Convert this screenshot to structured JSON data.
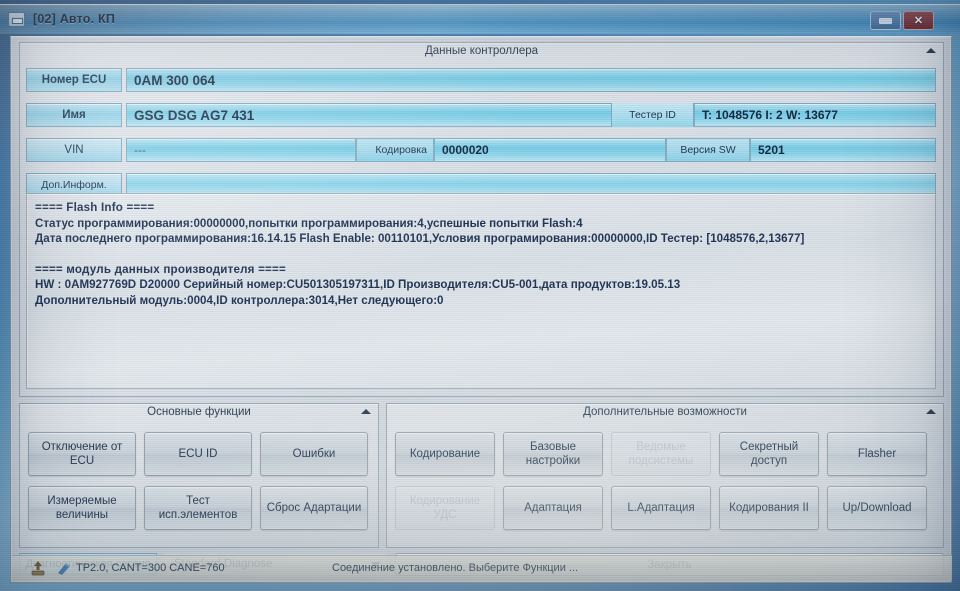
{
  "window": {
    "title": "[02] Авто. КП",
    "minimize_label": "minimize",
    "close_label": "✕"
  },
  "data_panel": {
    "group_title": "Данные контроллера",
    "fields": {
      "ecu_number_label": "Номер ECU",
      "ecu_number_value": "0AM 300 064",
      "name_label": "Имя",
      "name_value": "GSG DSG AG7     431",
      "tester_id_label": "Тестер ID",
      "tester_id_value": "T: 1048576 I: 2 W: 13677",
      "vin_label": "VIN",
      "vin_value": "---",
      "coding_label": "Кодировка",
      "coding_value": "0000020",
      "sw_version_label": "Версия SW",
      "sw_version_value": "5201",
      "extra_info_label": "Доп.Информ.",
      "extra_info_value": ""
    },
    "info_lines": [
      "==== Flash Info ====",
      "Статус программирования:00000000,попытки программирования:4,успешные попытки Flash:4",
      "Дата последнего программирования:16.14.15 Flash Enable: 00110101,Условия програмирования:00000000,ID Тестер: [1048576,2,13677]",
      "",
      "==== модуль данных производителя ====",
      "HW : 0AM927769D   D20000   Серийный номер:CU501305197311,ID Производителя:CU5-001,дата продуктов:19.05.13",
      "Дополнительный модуль:0004,ID контроллера:3014,Нет следующего:0"
    ]
  },
  "main_functions": {
    "group_title": "Основные функции",
    "buttons": [
      {
        "label": "Отключение от ECU",
        "enabled": true
      },
      {
        "label": "ECU ID",
        "enabled": true
      },
      {
        "label": "Ошибки",
        "enabled": true
      },
      {
        "label": "Измеряемые величины",
        "enabled": true
      },
      {
        "label": "Тест исп.элементов",
        "enabled": true
      },
      {
        "label": "Сброс Адартации",
        "enabled": true
      }
    ]
  },
  "extra_functions": {
    "group_title": "Дополнительные возможности",
    "buttons": [
      {
        "label": "Кодирование",
        "enabled": true
      },
      {
        "label": "Базовые настройки",
        "enabled": true
      },
      {
        "label": "Ведомые подсистемы",
        "enabled": false
      },
      {
        "label": "Секретный доступ",
        "enabled": true
      },
      {
        "label": "Flasher",
        "enabled": true
      },
      {
        "label": "Кодирование УДС",
        "enabled": false
      },
      {
        "label": "Адаптация",
        "enabled": true
      },
      {
        "label": "L.Адаптация",
        "enabled": true
      },
      {
        "label": "Кодирования II",
        "enabled": true
      },
      {
        "label": "Up/Download",
        "enabled": true
      }
    ]
  },
  "session": {
    "label": "Диагностическая сессия",
    "selected": "Standard Diagnose",
    "close_label": "Закрыть"
  },
  "status": {
    "protocol": "TP2.0, CANT=300 CANE=760",
    "message": "Соединение установлено. Выберите Функции ..."
  },
  "colors": {
    "field_accent": "#77cde8",
    "label_accent": "#8fd3ea",
    "text": "#12253c",
    "titlebar": "#4a9ad0",
    "close_button": "#6d2a32"
  }
}
